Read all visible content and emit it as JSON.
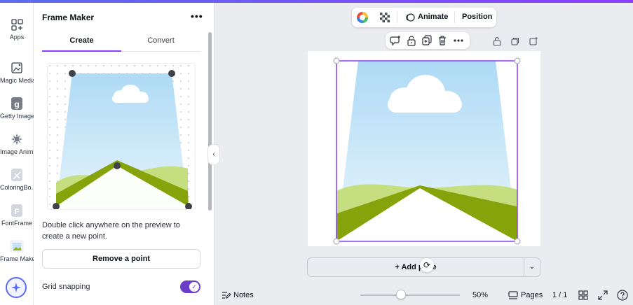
{
  "sidebar": {
    "items": [
      {
        "label": "Apps",
        "icon": "apps-icon"
      },
      {
        "label": "Magic Media",
        "icon": "magic-media-icon"
      },
      {
        "label": "Getty Images",
        "icon": "getty-images-icon"
      },
      {
        "label": "Image Anim...",
        "icon": "image-animate-icon"
      },
      {
        "label": "ColoringBo...",
        "icon": "coloring-book-icon"
      },
      {
        "label": "FontFrame",
        "icon": "fontframe-icon"
      },
      {
        "label": "Frame Maker",
        "icon": "frame-maker-icon"
      }
    ]
  },
  "panel": {
    "title": "Frame Maker",
    "more": "•••",
    "tabs": [
      {
        "label": "Create",
        "active": true
      },
      {
        "label": "Convert",
        "active": false
      }
    ],
    "help_text": "Double click anywhere on the preview to create a new point.",
    "remove_button": "Remove a point",
    "grid_snapping_label": "Grid snapping",
    "grid_snapping_on": true
  },
  "toolbar": {
    "animate": "Animate",
    "position": "Position"
  },
  "canvas": {
    "add_page": "+ Add page"
  },
  "footer": {
    "notes": "Notes",
    "zoom": "50%",
    "pages_label": "Pages",
    "page_count": "1 / 1"
  },
  "colors": {
    "accent": "#8b3dff",
    "toggle": "#6b3ec8",
    "sky_top": "#b3dcf5",
    "hill_dark": "#86a30b",
    "hill_light": "#c4de80"
  }
}
